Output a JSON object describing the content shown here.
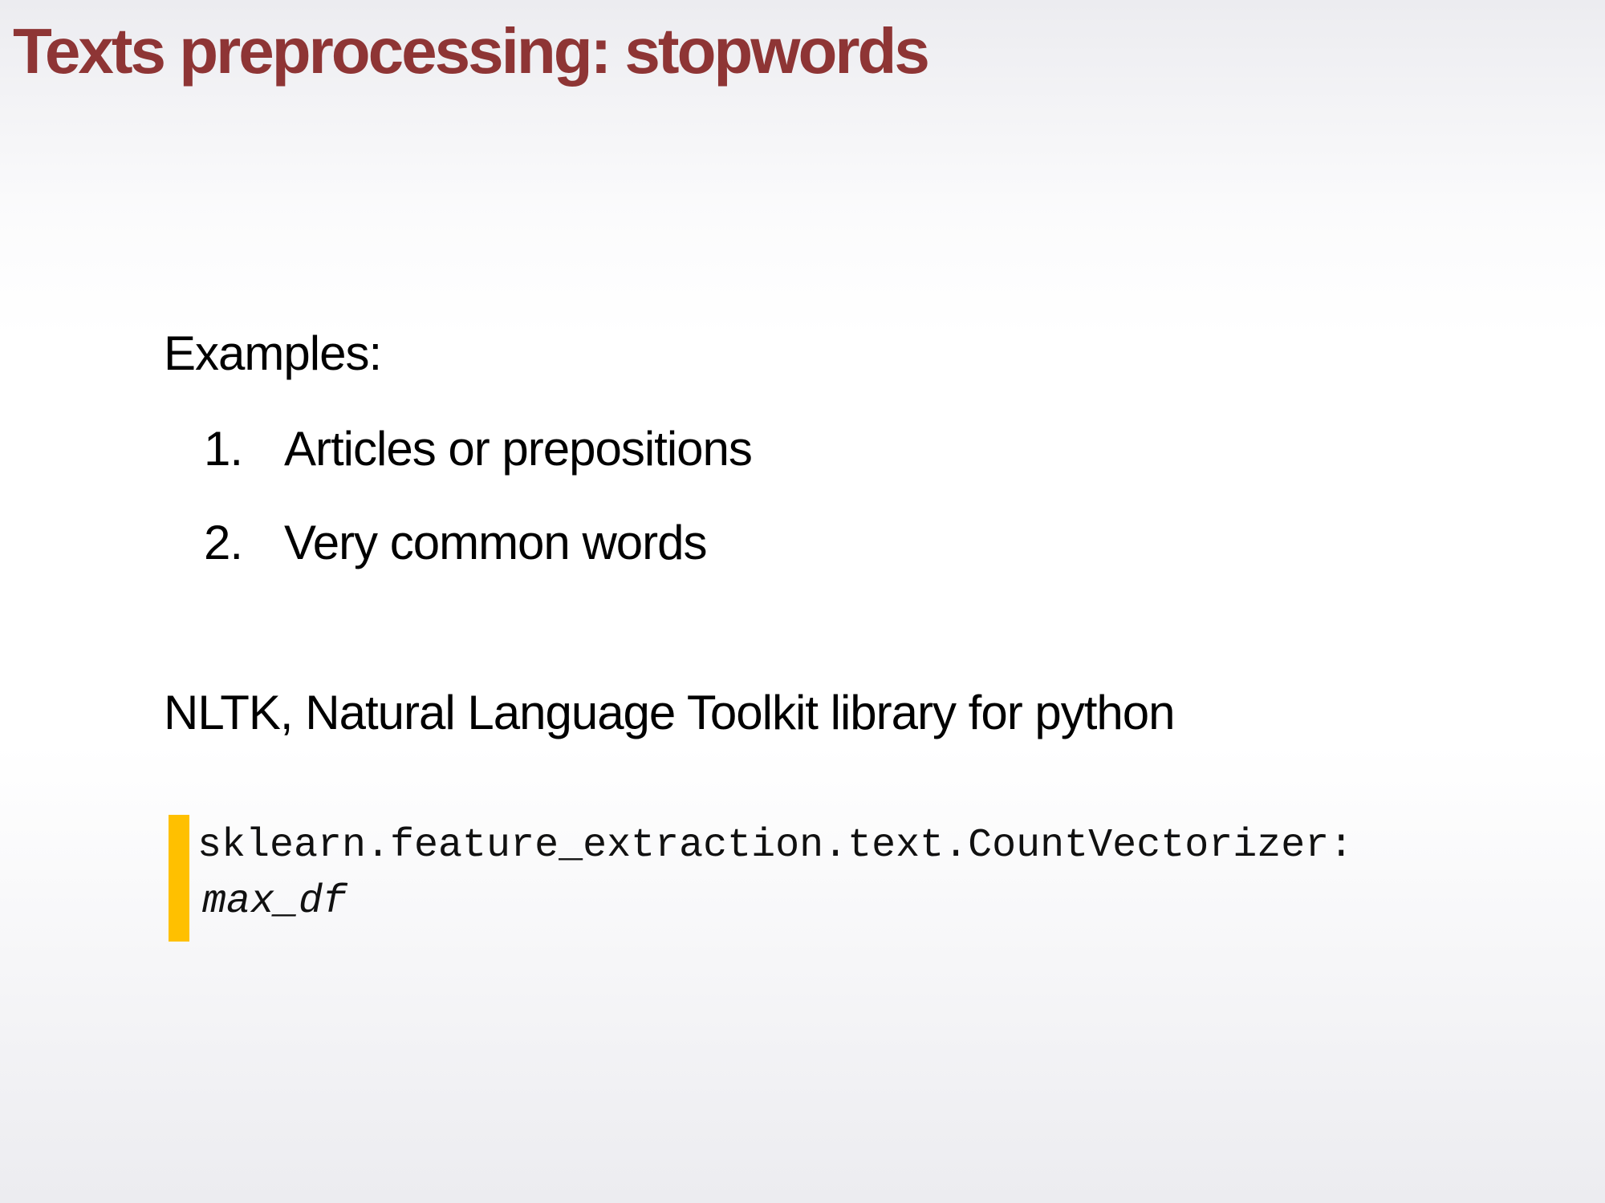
{
  "slide": {
    "title": "Texts preprocessing: stopwords",
    "examples_label": "Examples:",
    "list": [
      {
        "number": "1.",
        "text": "Articles or prepositions"
      },
      {
        "number": "2.",
        "text": "Very common words"
      }
    ],
    "nltk_text": "NLTK, Natural Language Toolkit library for python",
    "code": {
      "line1": "sklearn.feature_extraction.text.CountVectorizer:",
      "line2": "max_df"
    }
  },
  "colors": {
    "title": "#8e3535",
    "accent_bar": "#ffc000",
    "text": "#000000"
  }
}
